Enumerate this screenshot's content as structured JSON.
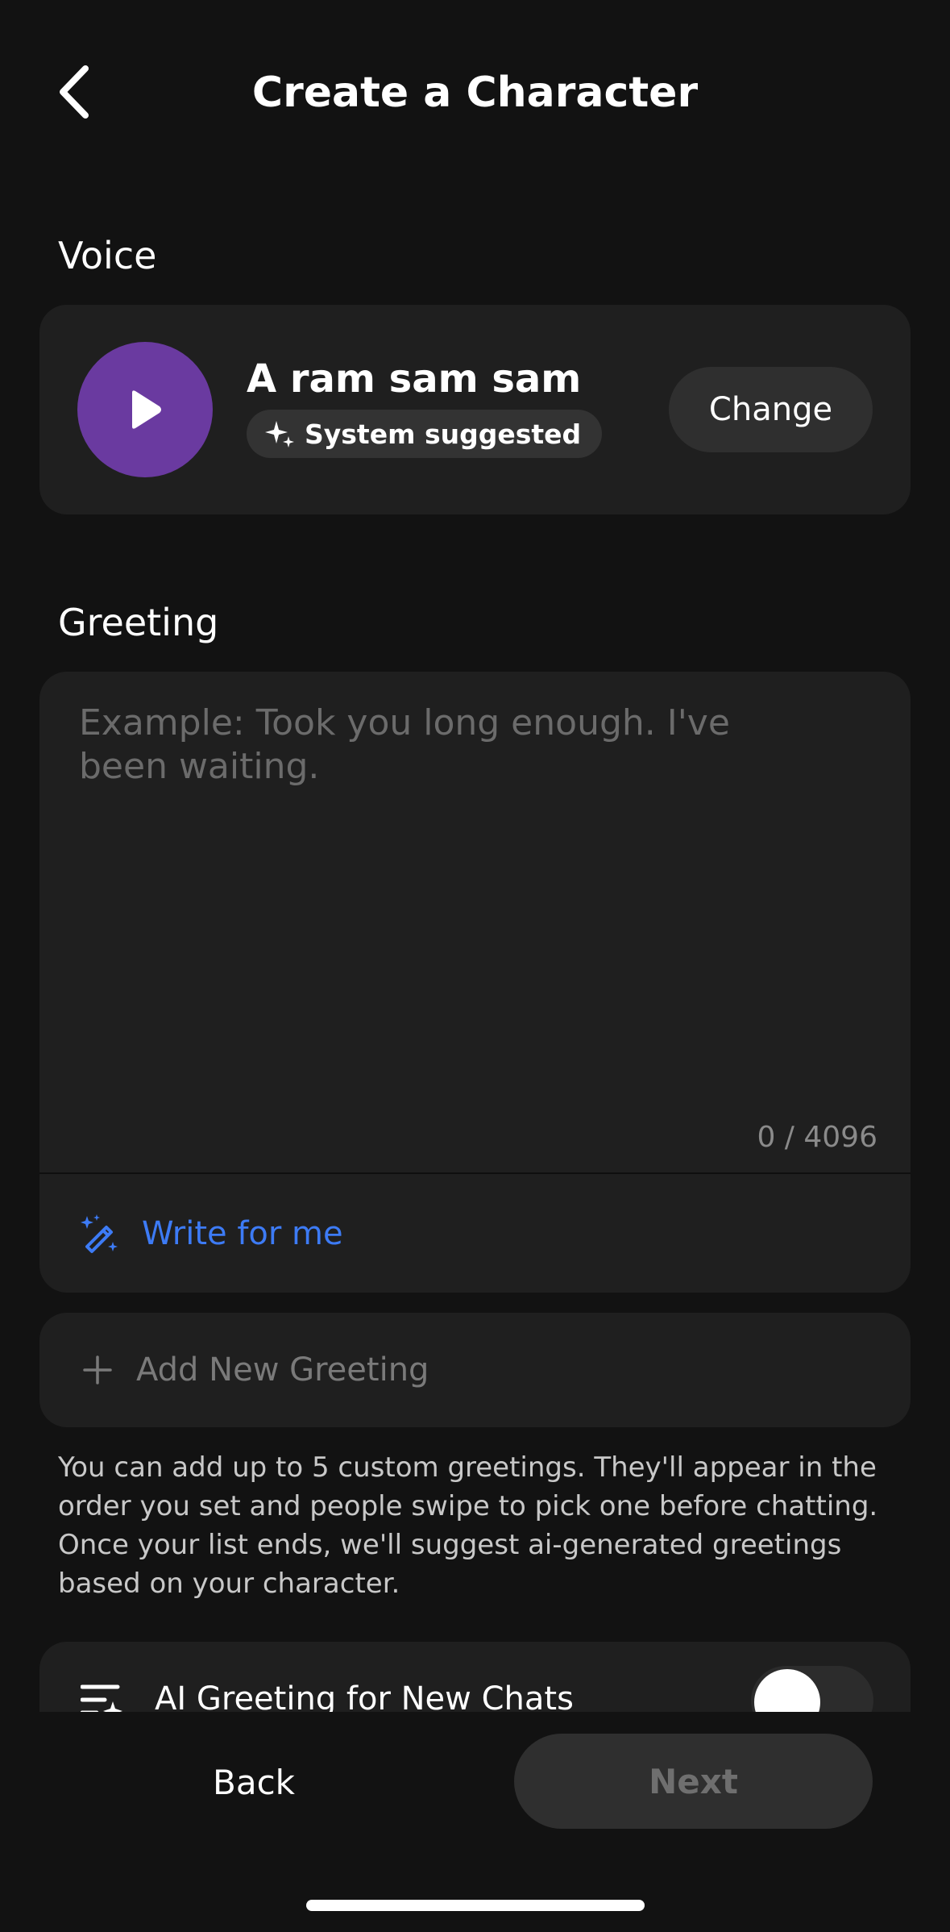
{
  "header": {
    "title": "Create a Character",
    "back_icon": "chevron-left-icon"
  },
  "voice": {
    "section_label": "Voice",
    "name": "A ram sam sam",
    "badge": "System suggested",
    "badge_icon": "sparkle-icon",
    "play_icon": "play-icon",
    "play_color": "#6a3aa0",
    "change_label": "Change"
  },
  "greeting": {
    "section_label": "Greeting",
    "placeholder": "Example: Took you long enough. I've been waiting.",
    "value": "",
    "char_count": "0 / 4096",
    "write_label": "Write for me",
    "write_icon": "magic-wand-icon",
    "write_color": "#3d7bf5",
    "add_label": "Add New Greeting",
    "add_icon": "plus-icon",
    "help_text": "You can add up to 5 custom greetings. They'll appear in the order you set and people swipe to pick one before chatting. Once your list ends, we'll suggest ai-generated greetings based on your character."
  },
  "ai_greeting": {
    "label": "AI Greeting for New Chats",
    "icon": "ai-list-icon",
    "enabled": true
  },
  "footer": {
    "back_label": "Back",
    "next_label": "Next"
  }
}
